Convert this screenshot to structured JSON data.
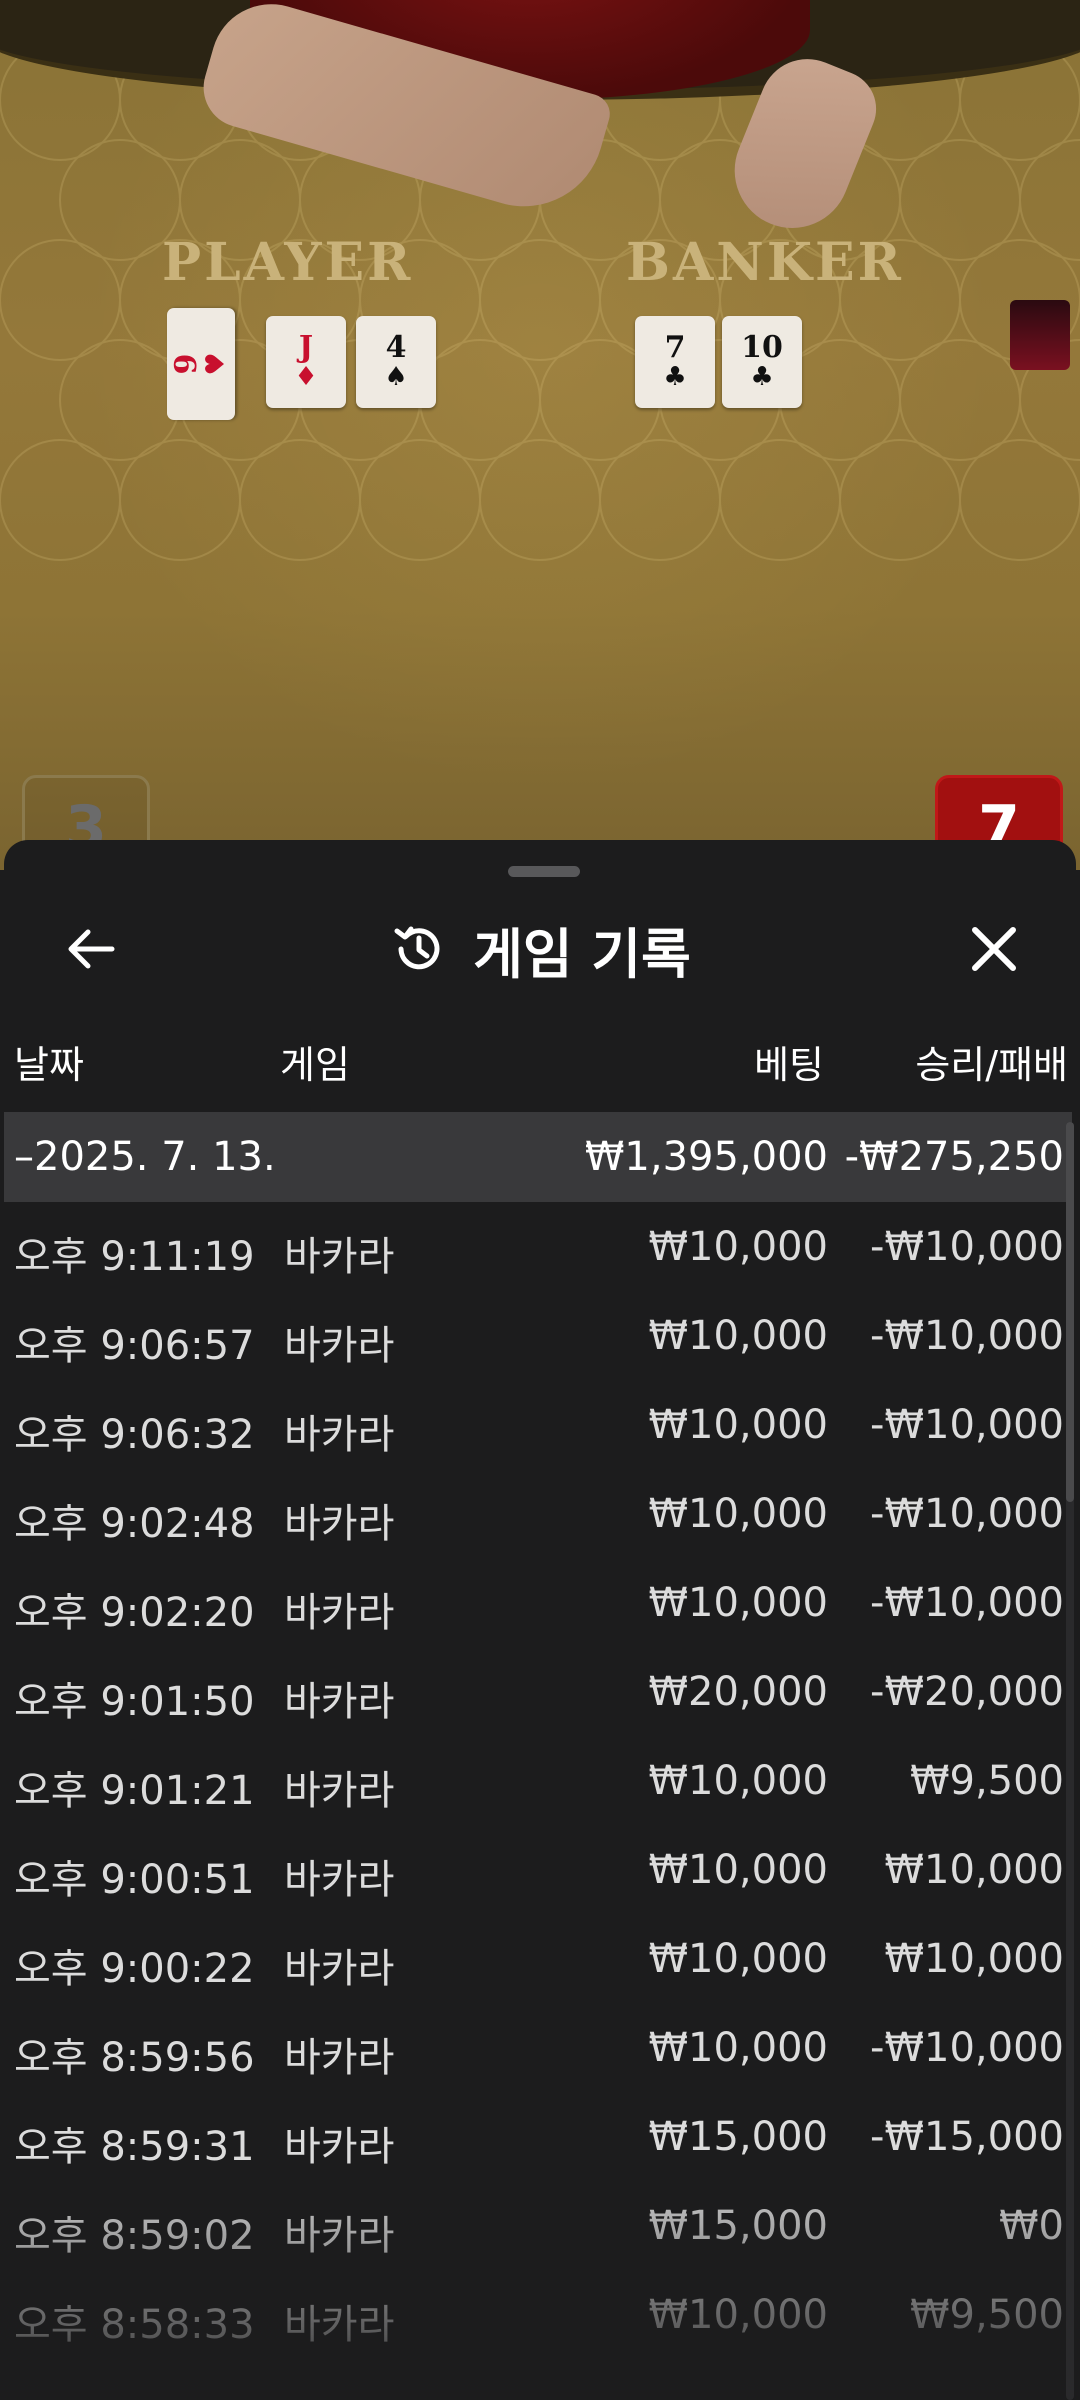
{
  "game_table": {
    "player_label": "PLAYER",
    "banker_label": "BANKER",
    "player_cards": [
      {
        "rank": "9",
        "suit": "♥",
        "color": "red"
      },
      {
        "rank": "J",
        "suit": "♦",
        "color": "red"
      },
      {
        "rank": "4",
        "suit": "♠",
        "color": "black"
      }
    ],
    "banker_cards": [
      {
        "rank": "7",
        "suit": "♣",
        "color": "black"
      },
      {
        "rank": "10",
        "suit": "♣",
        "color": "black"
      }
    ],
    "player_score": "3",
    "banker_score": "7"
  },
  "history": {
    "title": "게임 기록",
    "back_icon": "arrow-left-icon",
    "title_icon": "history-icon",
    "close_icon": "close-icon",
    "columns": {
      "date": "날짜",
      "game": "게임",
      "bet": "베팅",
      "result": "승리/패배"
    },
    "summary": {
      "date": "–2025. 7. 13.",
      "bet": "₩1,395,000",
      "result": "-₩275,250"
    },
    "rows": [
      {
        "time": "오후 9:11:19",
        "game": "바카라",
        "bet": "₩10,000",
        "result": "-₩10,000"
      },
      {
        "time": "오후 9:06:57",
        "game": "바카라",
        "bet": "₩10,000",
        "result": "-₩10,000"
      },
      {
        "time": "오후 9:06:32",
        "game": "바카라",
        "bet": "₩10,000",
        "result": "-₩10,000"
      },
      {
        "time": "오후 9:02:48",
        "game": "바카라",
        "bet": "₩10,000",
        "result": "-₩10,000"
      },
      {
        "time": "오후 9:02:20",
        "game": "바카라",
        "bet": "₩10,000",
        "result": "-₩10,000"
      },
      {
        "time": "오후 9:01:50",
        "game": "바카라",
        "bet": "₩20,000",
        "result": "-₩20,000"
      },
      {
        "time": "오후 9:01:21",
        "game": "바카라",
        "bet": "₩10,000",
        "result": "₩9,500"
      },
      {
        "time": "오후 9:00:51",
        "game": "바카라",
        "bet": "₩10,000",
        "result": "₩10,000"
      },
      {
        "time": "오후 9:00:22",
        "game": "바카라",
        "bet": "₩10,000",
        "result": "₩10,000"
      },
      {
        "time": "오후 8:59:56",
        "game": "바카라",
        "bet": "₩10,000",
        "result": "-₩10,000"
      },
      {
        "time": "오후 8:59:31",
        "game": "바카라",
        "bet": "₩15,000",
        "result": "-₩15,000"
      },
      {
        "time": "오후 8:59:02",
        "game": "바카라",
        "bet": "₩15,000",
        "result": "₩0"
      },
      {
        "time": "오후 8:58:33",
        "game": "바카라",
        "bet": "₩10,000",
        "result": "₩9,500"
      }
    ]
  },
  "colors": {
    "sheet_bg": "#1c1c1d",
    "summary_bg": "#39393b",
    "felt": "#94783a",
    "banker_chip": "#a21010"
  }
}
